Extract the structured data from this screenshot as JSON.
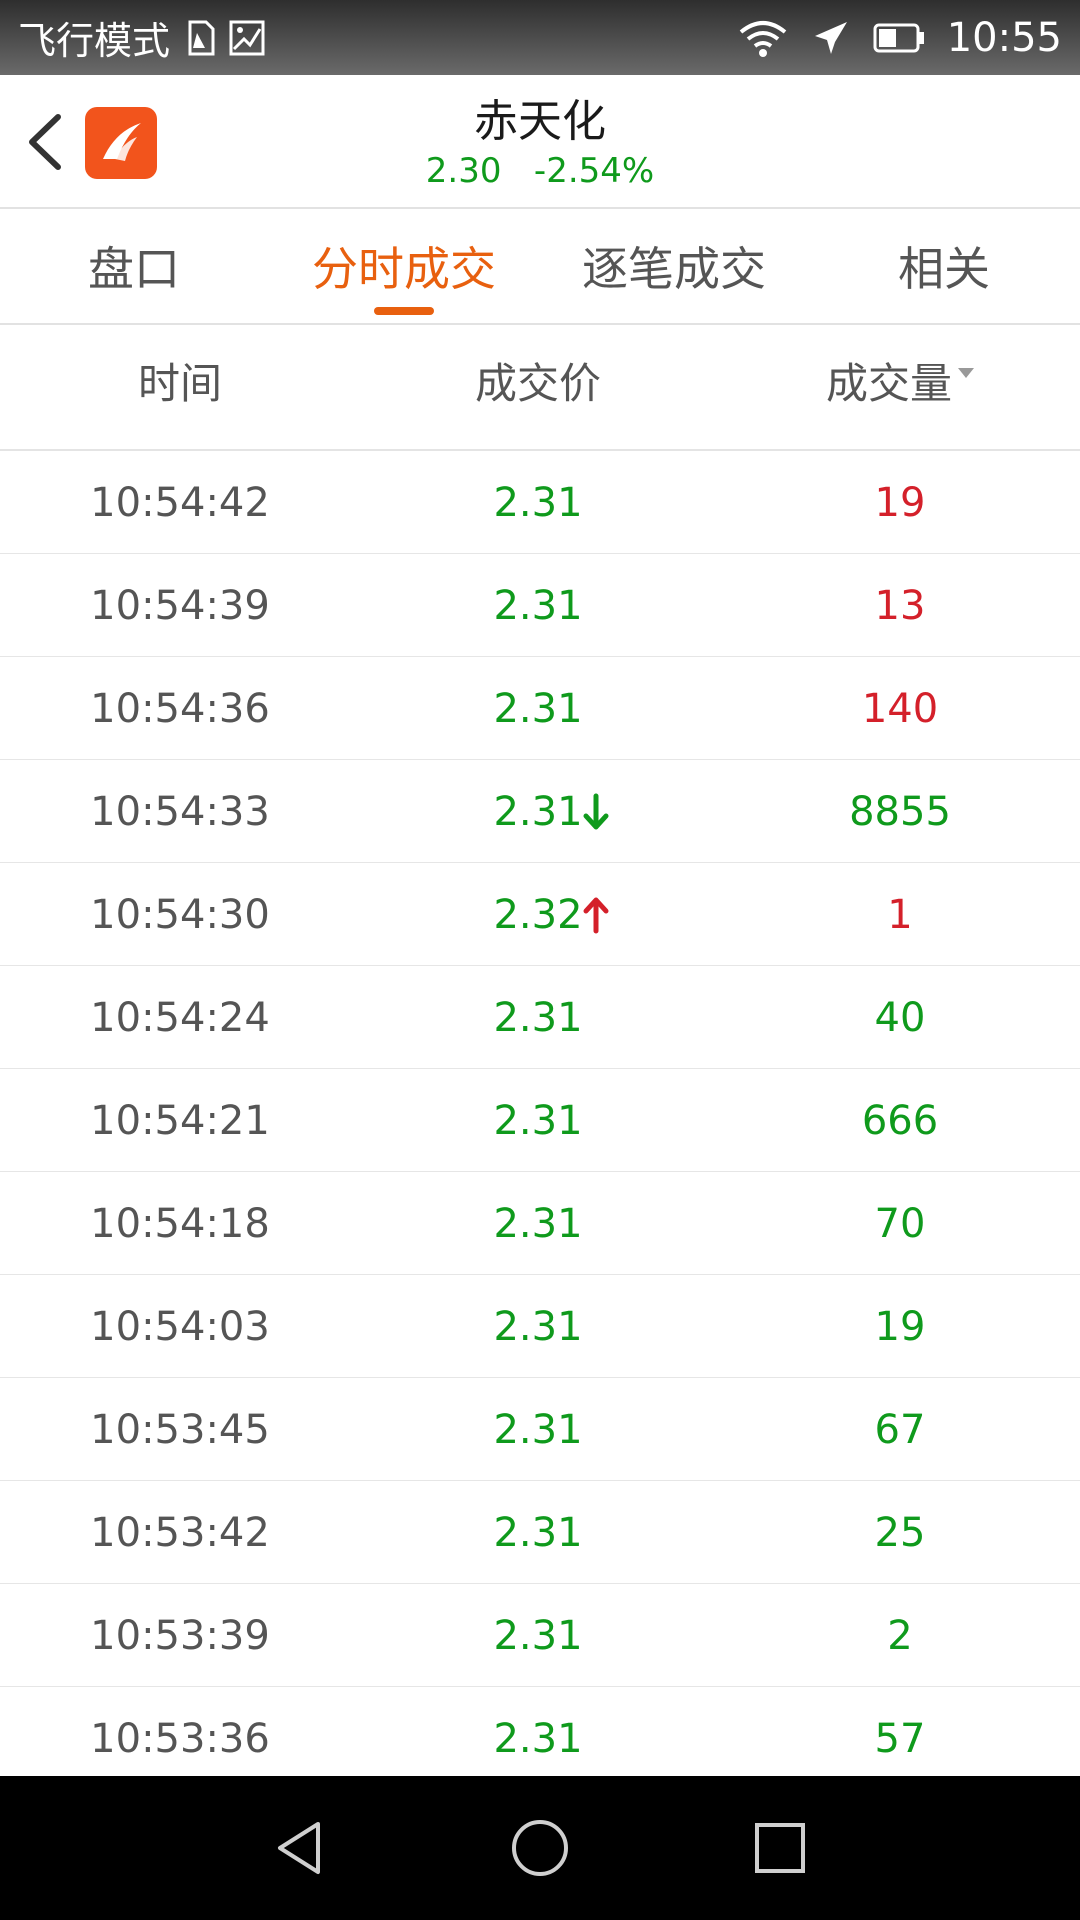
{
  "status_bar": {
    "mode_label": "飞行模式",
    "time": "10:55"
  },
  "header": {
    "stock_name": "赤天化",
    "price": "2.30",
    "change_percent": "-2.54%"
  },
  "tabs": [
    {
      "label": "盘口"
    },
    {
      "label": "分时成交",
      "active": true
    },
    {
      "label": "逐笔成交"
    },
    {
      "label": "相关"
    }
  ],
  "columns": {
    "time": "时间",
    "price": "成交价",
    "volume": "成交量"
  },
  "colors": {
    "up_red": "#d4202a",
    "down_green": "#0f9a1c",
    "accent_orange": "#e8600f"
  },
  "trades": [
    {
      "time": "10:54:42",
      "price": "2.31",
      "volume": "19",
      "volume_color": "red"
    },
    {
      "time": "10:54:39",
      "price": "2.31",
      "volume": "13",
      "volume_color": "red"
    },
    {
      "time": "10:54:36",
      "price": "2.31",
      "volume": "140",
      "volume_color": "red"
    },
    {
      "time": "10:54:33",
      "price": "2.31",
      "volume": "8855",
      "volume_color": "green",
      "arrow": "down"
    },
    {
      "time": "10:54:30",
      "price": "2.32",
      "volume": "1",
      "volume_color": "red",
      "arrow": "up"
    },
    {
      "time": "10:54:24",
      "price": "2.31",
      "volume": "40",
      "volume_color": "green"
    },
    {
      "time": "10:54:21",
      "price": "2.31",
      "volume": "666",
      "volume_color": "green"
    },
    {
      "time": "10:54:18",
      "price": "2.31",
      "volume": "70",
      "volume_color": "green"
    },
    {
      "time": "10:54:03",
      "price": "2.31",
      "volume": "19",
      "volume_color": "green"
    },
    {
      "time": "10:53:45",
      "price": "2.31",
      "volume": "67",
      "volume_color": "green"
    },
    {
      "time": "10:53:42",
      "price": "2.31",
      "volume": "25",
      "volume_color": "green"
    },
    {
      "time": "10:53:39",
      "price": "2.31",
      "volume": "2",
      "volume_color": "green"
    },
    {
      "time": "10:53:36",
      "price": "2.31",
      "volume": "57",
      "volume_color": "green"
    }
  ]
}
